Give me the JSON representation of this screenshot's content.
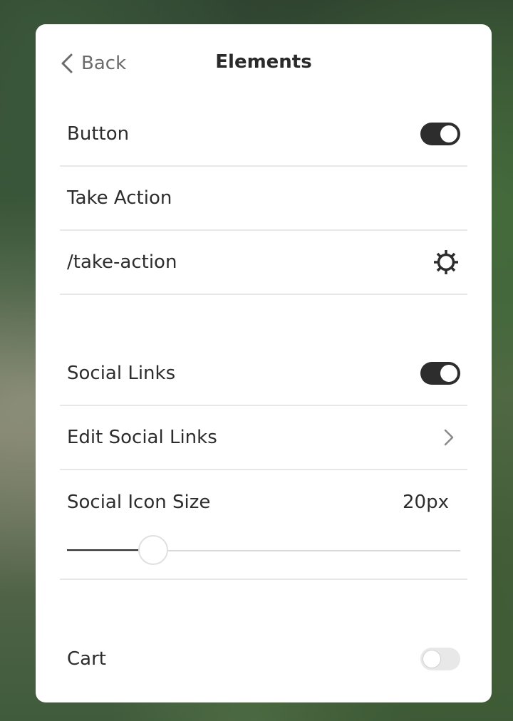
{
  "header": {
    "back_label": "Back",
    "title": "Elements"
  },
  "button_section": {
    "button_label": "Button",
    "button_enabled": true,
    "button_text": "Take Action",
    "button_link": "/take-action"
  },
  "social_section": {
    "social_links_label": "Social Links",
    "social_links_enabled": true,
    "edit_social_links_label": "Edit Social Links",
    "icon_size_label": "Social Icon Size",
    "icon_size_value": "20px",
    "icon_size_fraction": 0.22
  },
  "cart_section": {
    "cart_label": "Cart",
    "cart_enabled": false
  },
  "icons": {
    "back": "chevron-left-icon",
    "settings": "gear-icon",
    "edit": "chevron-right-icon"
  },
  "colors": {
    "accent": "#2d2d2d",
    "toggle_off": "#e8e8e8",
    "divider": "#e8e8e8"
  }
}
